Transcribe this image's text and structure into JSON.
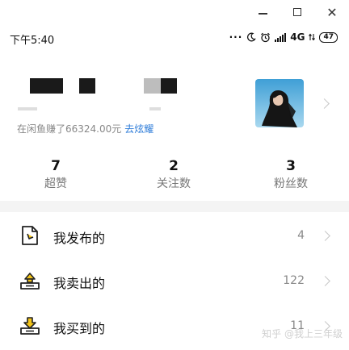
{
  "window": {
    "minimize_icon": "minimize-icon",
    "maximize_icon": "maximize-icon",
    "close_glyph": "✕"
  },
  "status_bar": {
    "time": "下午5:40",
    "network": "4G",
    "battery": "47"
  },
  "profile": {
    "earn_text": "在闲鱼赚了66324.00元",
    "earn_link": "去炫耀"
  },
  "stats": [
    {
      "value": "7",
      "label": "超赞"
    },
    {
      "value": "2",
      "label": "关注数"
    },
    {
      "value": "3",
      "label": "粉丝数"
    }
  ],
  "menu": [
    {
      "icon": "published-icon",
      "label": "我发布的",
      "count": "4"
    },
    {
      "icon": "sold-icon",
      "label": "我卖出的",
      "count": "122"
    },
    {
      "icon": "bought-icon",
      "label": "我买到的",
      "count": "11"
    }
  ],
  "watermark": "知乎 @我上三年级",
  "colors": {
    "link": "#2a7ad8",
    "divider": "#f4f4f4"
  }
}
